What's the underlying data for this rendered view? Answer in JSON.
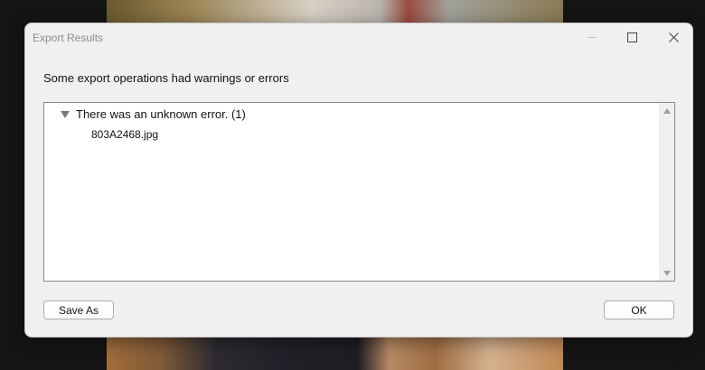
{
  "window": {
    "title": "Export Results"
  },
  "message": "Some export operations had warnings or errors",
  "results_tree": {
    "groups": [
      {
        "label": "There was an unknown error. (1)",
        "expanded": true,
        "items": [
          "803A2468.jpg"
        ]
      }
    ]
  },
  "buttons": {
    "save_as": "Save As",
    "ok": "OK"
  },
  "icons": {
    "minimize": "minimize-icon",
    "maximize": "maximize-icon",
    "close": "close-icon",
    "expander": "expand-triangle-icon",
    "scroll_up": "scroll-up-icon",
    "scroll_down": "scroll-down-icon"
  }
}
